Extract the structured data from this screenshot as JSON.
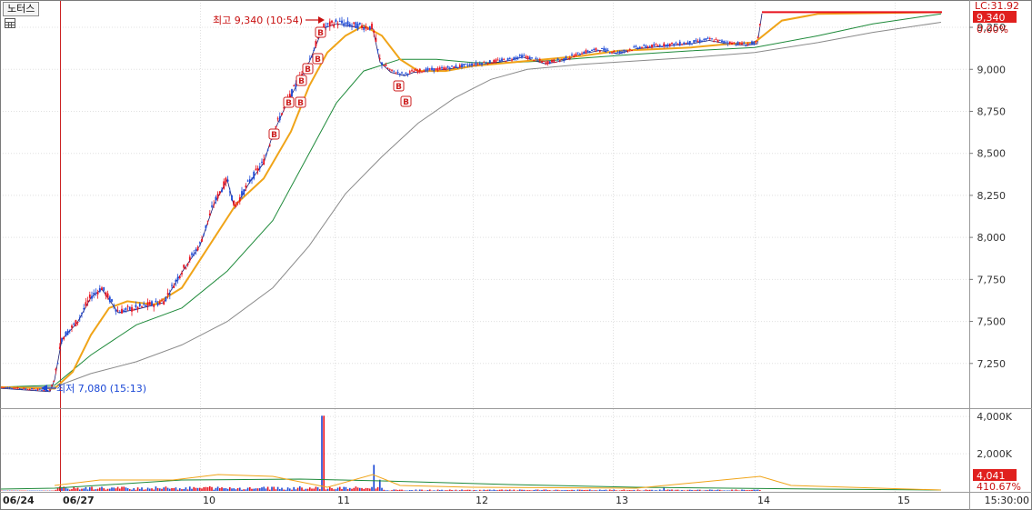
{
  "stock_name": "노터스",
  "colors": {
    "up": "#e8121e",
    "down": "#1b48d6",
    "ma5": "#1a1a6e",
    "ma20": "#f0a418",
    "ma60": "#1e8a3a",
    "ma120": "#8a8a8a",
    "grid": "#e0e0e0",
    "vline": "#cc2222"
  },
  "icons": {
    "grid_toggle": "table-grid-icon",
    "high_marker": "arrow-right-icon",
    "low_marker": "arrow-left-icon",
    "buy_signal": "b-badge-icon"
  },
  "chart_data": {
    "type": "candlestick",
    "price_axis": {
      "ticks": [
        "7,250",
        "7,500",
        "7,750",
        "8,000",
        "8,250",
        "8,500",
        "8,750",
        "9,000",
        "9,250"
      ],
      "range": [
        7000,
        9380
      ]
    },
    "volume_axis": {
      "ticks": [
        "2,000K",
        "4,000K"
      ],
      "range": [
        0,
        4300
      ]
    },
    "x_axis": {
      "labels": [
        "06/24",
        "06/27",
        "10",
        "11",
        "12",
        "13",
        "14",
        "15"
      ],
      "time_label": "15:30:00"
    },
    "high_annotation": "최고 9,340 (10:54)",
    "low_annotation": "최저 7,080 (15:13)",
    "right_badges": {
      "lc": "LC:31.92",
      "price": "9,340",
      "change": "0.00%",
      "volume": "4,041",
      "volume_ratio": "410.67%"
    },
    "price_path": [
      [
        0,
        7110
      ],
      [
        55,
        7090
      ],
      [
        60,
        7160
      ],
      [
        68,
        7400
      ],
      [
        85,
        7500
      ],
      [
        100,
        7650
      ],
      [
        112,
        7700
      ],
      [
        130,
        7560
      ],
      [
        150,
        7580
      ],
      [
        180,
        7620
      ],
      [
        200,
        7800
      ],
      [
        220,
        7960
      ],
      [
        235,
        8200
      ],
      [
        250,
        8350
      ],
      [
        258,
        8180
      ],
      [
        275,
        8340
      ],
      [
        290,
        8450
      ],
      [
        300,
        8620
      ],
      [
        315,
        8800
      ],
      [
        325,
        8900
      ],
      [
        340,
        9050
      ],
      [
        355,
        9250
      ],
      [
        370,
        9280
      ],
      [
        390,
        9260
      ],
      [
        410,
        9250
      ],
      [
        418,
        9050
      ],
      [
        430,
        8990
      ],
      [
        445,
        8970
      ],
      [
        455,
        8990
      ],
      [
        480,
        9000
      ],
      [
        520,
        9030
      ],
      [
        560,
        9060
      ],
      [
        575,
        9080
      ],
      [
        600,
        9040
      ],
      [
        620,
        9060
      ],
      [
        640,
        9100
      ],
      [
        660,
        9120
      ],
      [
        680,
        9100
      ],
      [
        700,
        9130
      ],
      [
        720,
        9140
      ],
      [
        740,
        9150
      ],
      [
        760,
        9160
      ],
      [
        780,
        9180
      ],
      [
        800,
        9160
      ],
      [
        820,
        9150
      ],
      [
        833,
        9160
      ],
      [
        838,
        9340
      ]
    ],
    "ma20_path": [
      [
        0,
        7110
      ],
      [
        60,
        7100
      ],
      [
        80,
        7200
      ],
      [
        100,
        7420
      ],
      [
        120,
        7580
      ],
      [
        140,
        7620
      ],
      [
        170,
        7600
      ],
      [
        200,
        7700
      ],
      [
        230,
        7950
      ],
      [
        260,
        8200
      ],
      [
        290,
        8350
      ],
      [
        320,
        8630
      ],
      [
        340,
        8900
      ],
      [
        360,
        9100
      ],
      [
        380,
        9200
      ],
      [
        400,
        9260
      ],
      [
        420,
        9200
      ],
      [
        440,
        9060
      ],
      [
        460,
        8990
      ],
      [
        490,
        8990
      ],
      [
        520,
        9020
      ],
      [
        560,
        9040
      ],
      [
        600,
        9060
      ],
      [
        640,
        9080
      ],
      [
        680,
        9110
      ],
      [
        720,
        9120
      ],
      [
        760,
        9130
      ],
      [
        800,
        9150
      ],
      [
        830,
        9160
      ],
      [
        860,
        9290
      ],
      [
        900,
        9330
      ],
      [
        1035,
        9340
      ]
    ],
    "ma60_path": [
      [
        0,
        7110
      ],
      [
        60,
        7120
      ],
      [
        100,
        7300
      ],
      [
        150,
        7480
      ],
      [
        200,
        7580
      ],
      [
        250,
        7800
      ],
      [
        300,
        8100
      ],
      [
        340,
        8500
      ],
      [
        370,
        8800
      ],
      [
        400,
        8990
      ],
      [
        440,
        9060
      ],
      [
        480,
        9060
      ],
      [
        520,
        9040
      ],
      [
        560,
        9040
      ],
      [
        600,
        9050
      ],
      [
        650,
        9070
      ],
      [
        700,
        9090
      ],
      [
        760,
        9110
      ],
      [
        830,
        9130
      ],
      [
        900,
        9200
      ],
      [
        960,
        9270
      ],
      [
        1035,
        9330
      ]
    ],
    "ma120_path": [
      [
        0,
        7110
      ],
      [
        60,
        7110
      ],
      [
        100,
        7190
      ],
      [
        150,
        7260
      ],
      [
        200,
        7360
      ],
      [
        250,
        7500
      ],
      [
        300,
        7700
      ],
      [
        340,
        7950
      ],
      [
        380,
        8260
      ],
      [
        420,
        8480
      ],
      [
        460,
        8680
      ],
      [
        500,
        8830
      ],
      [
        540,
        8940
      ],
      [
        580,
        9000
      ],
      [
        640,
        9030
      ],
      [
        700,
        9050
      ],
      [
        760,
        9070
      ],
      [
        830,
        9100
      ],
      [
        900,
        9160
      ],
      [
        960,
        9220
      ],
      [
        1035,
        9280
      ]
    ],
    "volume_spikes": [
      [
        68,
        150
      ],
      [
        95,
        200
      ],
      [
        120,
        120
      ],
      [
        190,
        150
      ],
      [
        230,
        250
      ],
      [
        275,
        200
      ],
      [
        300,
        220
      ],
      [
        330,
        250
      ],
      [
        355,
        4041
      ],
      [
        412,
        1400
      ],
      [
        418,
        600
      ],
      [
        730,
        200
      ],
      [
        838,
        1300
      ],
      [
        840,
        600
      ]
    ]
  }
}
